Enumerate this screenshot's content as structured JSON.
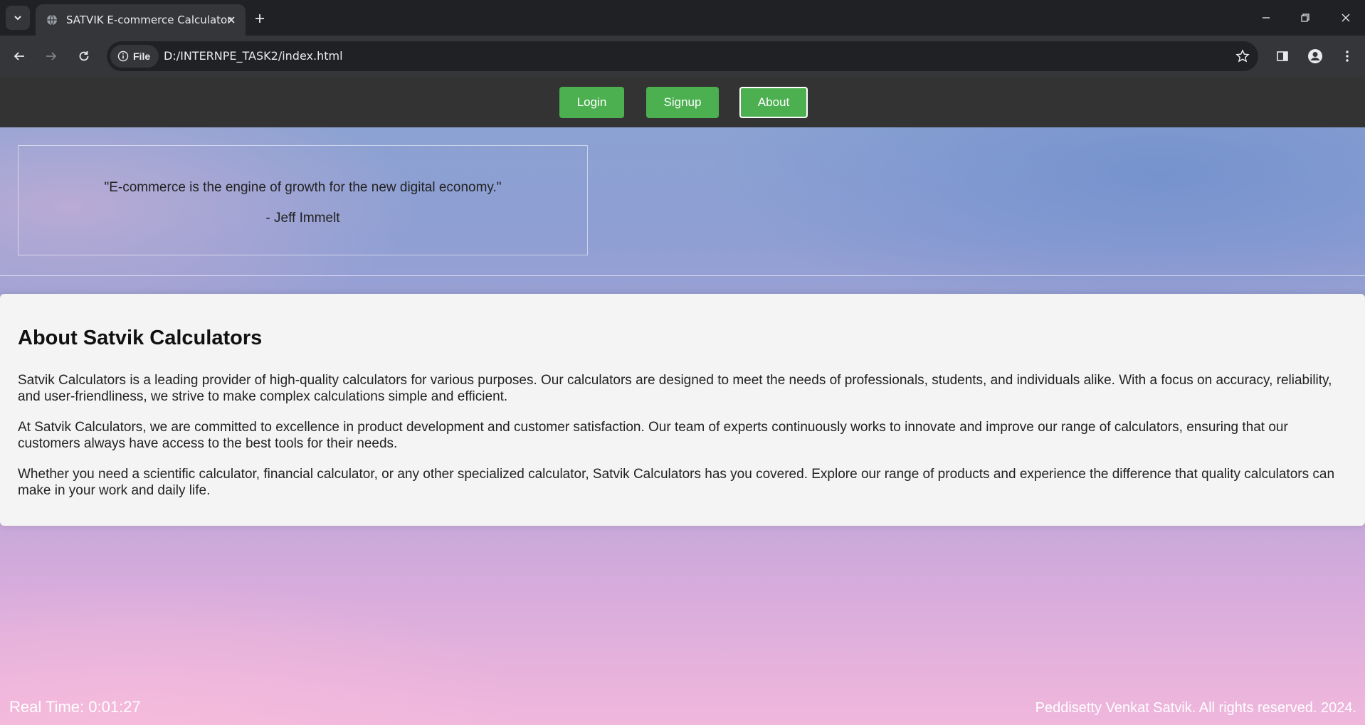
{
  "browser": {
    "tab_title": "SATVIK E-commerce Calculator",
    "site_chip_label": "File",
    "url": "D:/INTERNPE_TASK2/index.html"
  },
  "nav": {
    "login": "Login",
    "signup": "Signup",
    "about": "About"
  },
  "quote": {
    "text": "\"E-commerce is the engine of growth for the new digital economy.\"",
    "author": "- Jeff Immelt"
  },
  "about": {
    "title": "About Satvik Calculators",
    "paragraphs": [
      "Satvik Calculators is a leading provider of high-quality calculators for various purposes. Our calculators are designed to meet the needs of professionals, students, and individuals alike. With a focus on accuracy, reliability, and user-friendliness, we strive to make complex calculations simple and efficient.",
      "At Satvik Calculators, we are committed to excellence in product development and customer satisfaction. Our team of experts continuously works to innovate and improve our range of calculators, ensuring that our customers always have access to the best tools for their needs.",
      "Whether you need a scientific calculator, financial calculator, or any other specialized calculator, Satvik Calculators has you covered. Explore our range of products and experience the difference that quality calculators can make in your work and daily life."
    ]
  },
  "status": {
    "real_time": "Real Time: 0:01:27",
    "footer": "Peddisetty Venkat Satvik. All rights reserved. 2024."
  },
  "colors": {
    "nav_bg": "#333333",
    "button_green": "#4caf50",
    "card_bg": "#f4f4f4"
  }
}
